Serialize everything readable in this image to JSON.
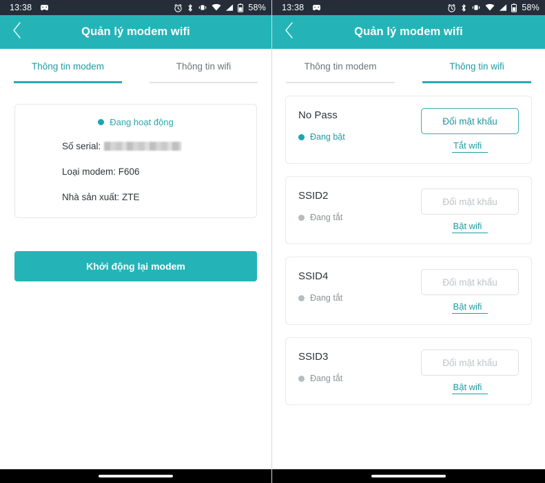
{
  "statusbar": {
    "time": "13:38",
    "left_icons": [
      "game-controller-icon"
    ],
    "right_icons": [
      "alarm-icon",
      "bluetooth-icon",
      "vibrate-icon",
      "wifi-icon",
      "signal-icon",
      "battery-icon"
    ],
    "battery_text": "58%"
  },
  "appbar": {
    "title": "Quản lý modem wifi",
    "back_icon": "chevron-left-icon"
  },
  "tabs": {
    "modem_label": "Thông tin modem",
    "wifi_label": "Thông tin wifi"
  },
  "colors": {
    "teal": "#24b4b8",
    "teal_text": "#1f9ba0",
    "statusbar_bg": "#272c39",
    "muted": "#8d9295",
    "disabled_border": "#dcdfe1",
    "disabled_text": "#bec3c6",
    "card_border": "#e8eaec"
  },
  "left_screen": {
    "active_tab": "Thông tin modem",
    "modem_card": {
      "status_label": "Đang hoạt động",
      "status_active": true,
      "serial_label": "Số serial:",
      "serial_value": "",
      "serial_redacted": true,
      "model_label": "Loại modem: F606",
      "manufacturer_label": "Nhà sản xuất: ZTE"
    },
    "restart_button_label": "Khởi động lại modem"
  },
  "right_screen": {
    "active_tab": "Thông tin wifi",
    "wifi_networks": [
      {
        "ssid": "No Pass",
        "state_label": "Đang bật",
        "enabled": true,
        "password_button_label": "Đổi mật khẩu",
        "toggle_label": "Tắt wifi"
      },
      {
        "ssid": "SSID2",
        "state_label": "Đang tắt",
        "enabled": false,
        "password_button_label": "Đổi mật khẩu",
        "toggle_label": "Bật wifi"
      },
      {
        "ssid": "SSID4",
        "state_label": "Đang tắt",
        "enabled": false,
        "password_button_label": "Đổi mật khẩu",
        "toggle_label": "Bật wifi"
      },
      {
        "ssid": "SSID3",
        "state_label": "Đang tắt",
        "enabled": false,
        "password_button_label": "Đổi mật khẩu",
        "toggle_label": "Bật wifi"
      }
    ]
  }
}
